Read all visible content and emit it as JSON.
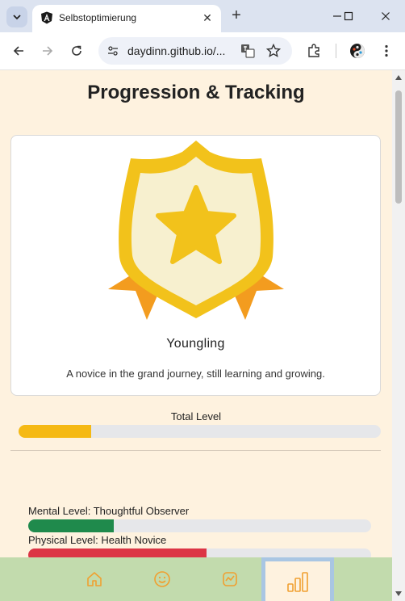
{
  "browser": {
    "tab_title": "Selbstoptimierung",
    "url": "daydinn.github.io/..."
  },
  "page": {
    "title": "Progression & Tracking",
    "rank": {
      "name": "Youngling",
      "description": "A novice in the grand journey, still learning and growing.",
      "badge_icon": "shield-star-badge"
    },
    "total_level": {
      "label": "Total Level",
      "progress": 0.2,
      "color": "#f5b914"
    },
    "levels": [
      {
        "label": "Mental Level: Thoughtful Observer",
        "progress": 0.25,
        "color": "#1f8a4c"
      },
      {
        "label": "Physical Level: Health Novice",
        "progress": 0.52,
        "color": "#dc3545"
      }
    ]
  },
  "nav": {
    "items": [
      {
        "name": "home",
        "icon": "house-icon"
      },
      {
        "name": "mood",
        "icon": "smiley-icon"
      },
      {
        "name": "activity",
        "icon": "chart-pulse-icon"
      },
      {
        "name": "progress",
        "icon": "bar-chart-icon",
        "active": true
      }
    ],
    "icon_color": "#f0a030"
  },
  "colors": {
    "page_background": "#fef2df",
    "nav_background": "#c2dbad",
    "badge_gold": "#f2c21b",
    "badge_cream": "#f7f0cf",
    "ribbon_orange": "#f39c1f"
  }
}
